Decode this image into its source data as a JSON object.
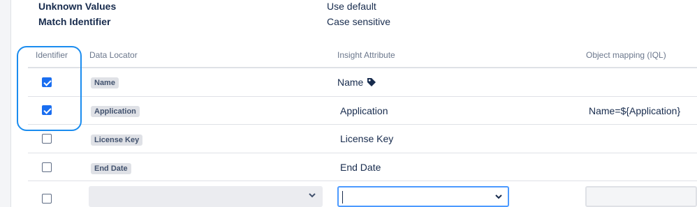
{
  "properties": [
    {
      "label": "Unknown Values",
      "value": "Use default"
    },
    {
      "label": "Match Identifier",
      "value": "Case sensitive"
    }
  ],
  "table": {
    "headers": {
      "identifier": "Identifier",
      "data_locator": "Data Locator",
      "insight_attribute": "Insight Attribute",
      "object_mapping": "Object mapping (IQL)"
    },
    "rows": [
      {
        "identifier": true,
        "data_locator": "Name",
        "attribute": "Name",
        "iql": ""
      },
      {
        "identifier": true,
        "data_locator": "Application",
        "attribute": "Application",
        "iql": "Name=${Application}"
      },
      {
        "identifier": false,
        "data_locator": "License Key",
        "attribute": "License Key",
        "iql": ""
      },
      {
        "identifier": false,
        "data_locator": "End Date",
        "attribute": "End Date",
        "iql": ""
      }
    ],
    "new_row": {
      "identifier": false,
      "data_locator_value": "",
      "attribute_value": "",
      "iql_value": ""
    }
  },
  "icons": {
    "label_tag": "tag-icon",
    "dropdown": "chevron-down-icon"
  },
  "colors": {
    "accent": "#1a6ef0",
    "highlight": "#1a8cef",
    "focus": "#4c9aff"
  }
}
